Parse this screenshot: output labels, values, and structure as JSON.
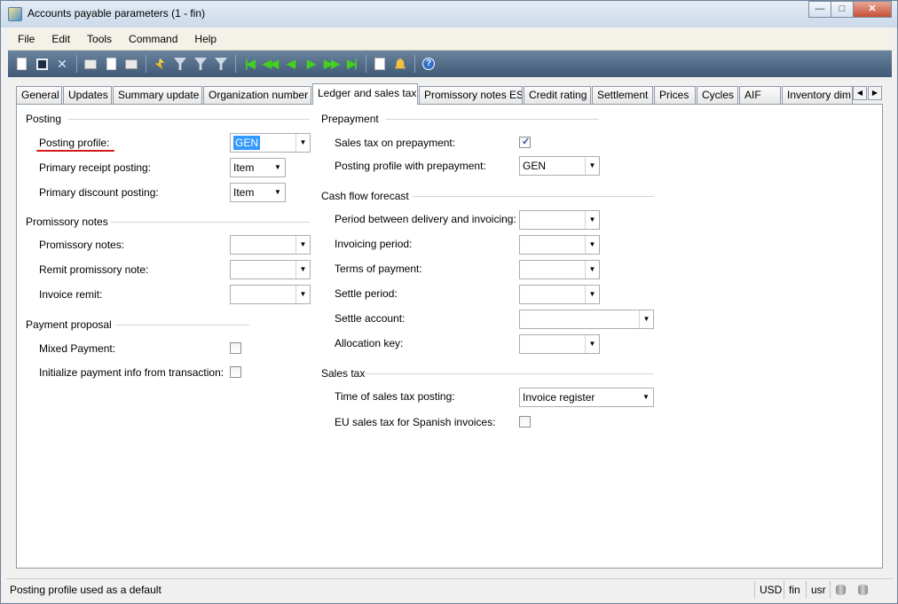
{
  "window": {
    "title": "Accounts payable parameters (1 - fin)",
    "controls": {
      "minimize": "—",
      "maximize": "□",
      "close": "✕"
    }
  },
  "menu": [
    "File",
    "Edit",
    "Tools",
    "Command",
    "Help"
  ],
  "tabs": [
    {
      "label": "General"
    },
    {
      "label": "Updates"
    },
    {
      "label": "Summary update"
    },
    {
      "label": "Organization number"
    },
    {
      "label": "Ledger and sales tax",
      "active": true
    },
    {
      "label": "Promissory notes ES"
    },
    {
      "label": "Credit rating"
    },
    {
      "label": "Settlement"
    },
    {
      "label": "Prices"
    },
    {
      "label": "Cycles"
    },
    {
      "label": "AIF"
    },
    {
      "label": "Inventory dim"
    }
  ],
  "posting": {
    "group": "Posting",
    "posting_profile": {
      "label": "Posting profile:",
      "value": "GEN"
    },
    "primary_receipt": {
      "label": "Primary receipt posting:",
      "value": "Item"
    },
    "primary_discount": {
      "label": "Primary discount posting:",
      "value": "Item"
    }
  },
  "promissory": {
    "group": "Promissory notes",
    "notes": {
      "label": "Promissory notes:",
      "value": ""
    },
    "remit": {
      "label": "Remit promissory note:",
      "value": ""
    },
    "invoice_remit": {
      "label": "Invoice remit:",
      "value": ""
    }
  },
  "payment_proposal": {
    "group": "Payment proposal",
    "mixed": {
      "label": "Mixed Payment:",
      "checked": false
    },
    "init_info": {
      "label": "Initialize payment info from transaction:",
      "checked": false
    }
  },
  "prepayment": {
    "group": "Prepayment",
    "sales_tax": {
      "label": "Sales tax on prepayment:",
      "checked": true,
      "mark": "✓"
    },
    "profile": {
      "label": "Posting profile with prepayment:",
      "value": "GEN"
    }
  },
  "cash_flow": {
    "group": "Cash flow forecast",
    "period_delivery": {
      "label": "Period between delivery and invoicing:",
      "value": ""
    },
    "invoicing_period": {
      "label": "Invoicing period:",
      "value": ""
    },
    "terms": {
      "label": "Terms of payment:",
      "value": ""
    },
    "settle_period": {
      "label": "Settle period:",
      "value": ""
    },
    "settle_account": {
      "label": "Settle account:",
      "value": ""
    },
    "allocation": {
      "label": "Allocation key:",
      "value": ""
    }
  },
  "sales_tax": {
    "group": "Sales tax",
    "time": {
      "label": "Time of sales tax posting:",
      "value": "Invoice register"
    },
    "eu": {
      "label": "EU sales tax for Spanish invoices:",
      "checked": false
    }
  },
  "status": {
    "message": "Posting profile used as a default",
    "currency": "USD",
    "company": "fin",
    "layer": "usr"
  },
  "icons": {
    "dropdown": "▼",
    "tab_left": "◀",
    "tab_right": "▶",
    "help": "?"
  }
}
